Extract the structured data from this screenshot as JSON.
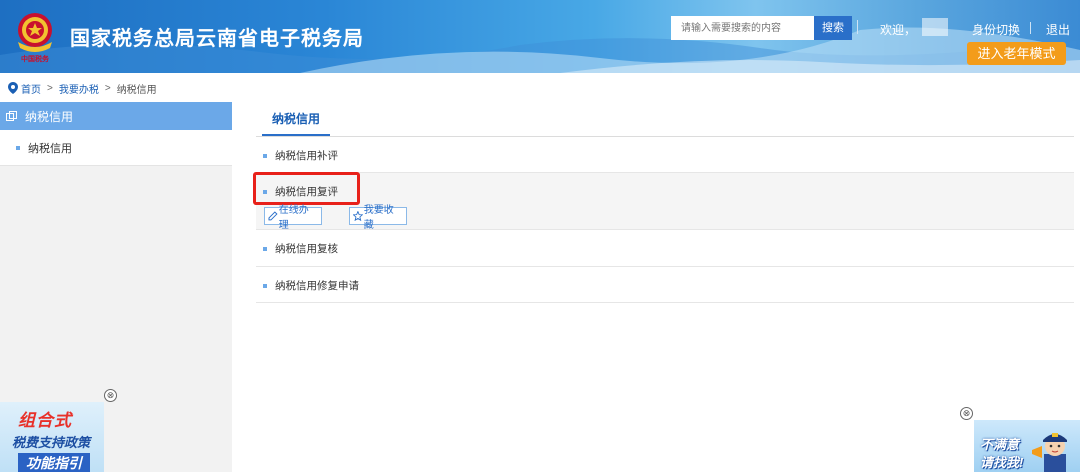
{
  "header": {
    "title": "国家税务总局云南省电子税务局",
    "emblem_caption": "中国税务",
    "search_placeholder": "请输入需要搜索的内容",
    "search_button": "搜索",
    "welcome": "欢迎，",
    "switch_identity": "身份切换",
    "separator": "|",
    "logout": "退出",
    "elder_mode": "进入老年模式"
  },
  "breadcrumb": {
    "items": [
      "首页",
      "我要办税",
      "纳税信用"
    ],
    "separator": ">"
  },
  "sidebar": {
    "heading": "纳税信用",
    "items": [
      {
        "label": "纳税信用"
      }
    ]
  },
  "main": {
    "tab": "纳税信用",
    "rows": [
      {
        "label": "纳税信用补评"
      },
      {
        "label": "纳税信用复评",
        "actions": [
          "在线办理",
          "我要收藏"
        ]
      },
      {
        "label": "纳税信用复核"
      },
      {
        "label": "纳税信用修复申请"
      }
    ]
  },
  "ads": {
    "left": {
      "line1": "组合式",
      "line2": "税费支持政策",
      "line3": "功能指引"
    },
    "right": {
      "line1": "不满意",
      "line2": "请找我!"
    },
    "close_symbol": "⊗"
  },
  "colors": {
    "header_blue": "#2a86d6",
    "accent_blue": "#2a6fc9",
    "sidebar_head": "#6ba8e8",
    "elder_orange": "#f39c1a",
    "highlight_red": "#e8211a"
  }
}
